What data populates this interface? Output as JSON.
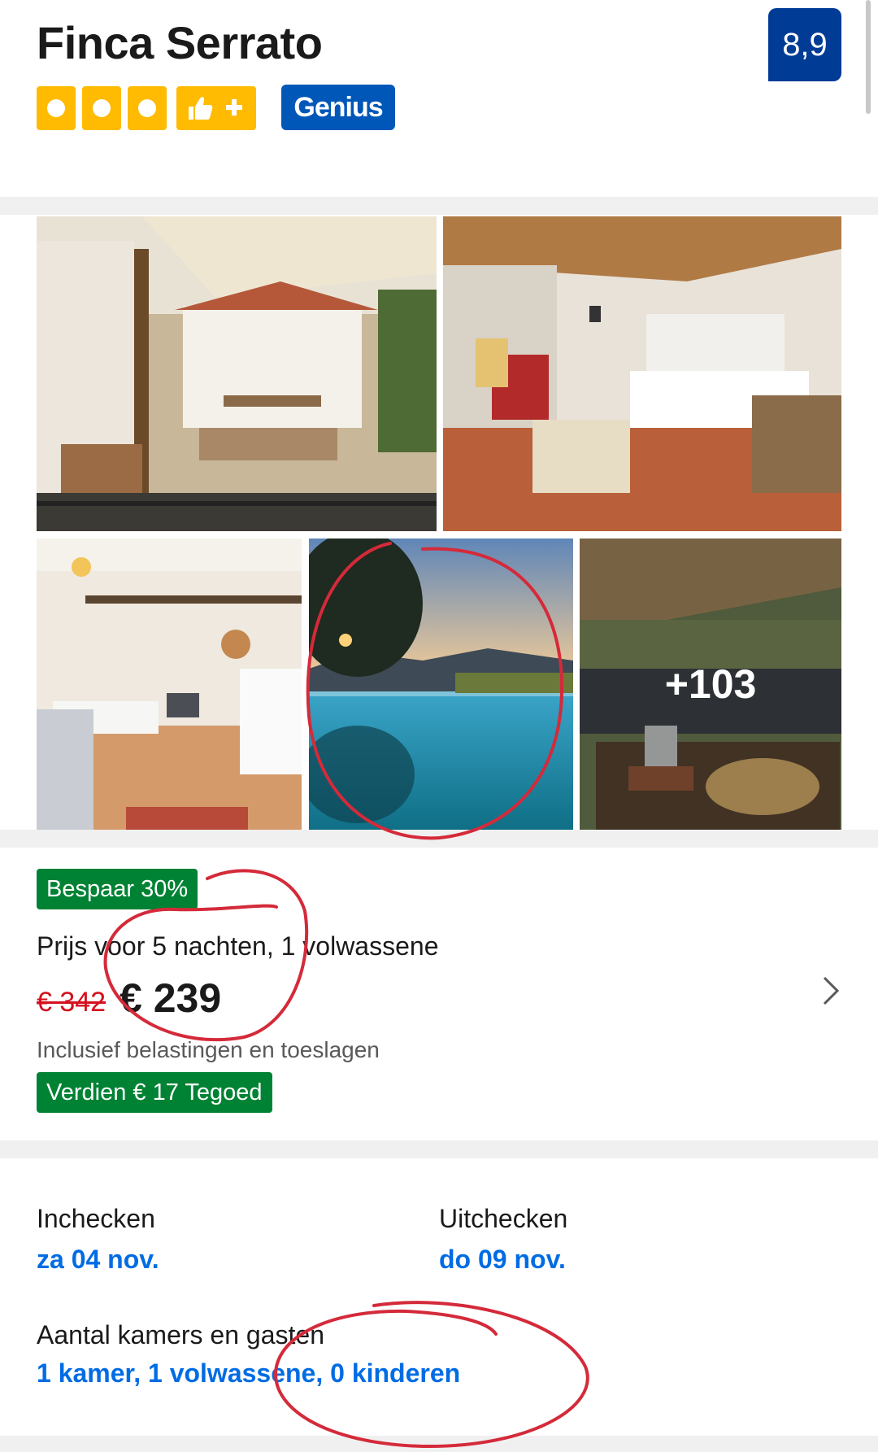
{
  "header": {
    "title": "Finca Serrato",
    "score": "8,9",
    "genius_label": "Genius"
  },
  "gallery": {
    "more_count": "+103"
  },
  "pricing": {
    "discount_badge": "Bespaar 30%",
    "price_description": "Prijs voor 5 nachten, 1 volwassene",
    "old_price": "€ 342",
    "new_price": "€ 239",
    "includes_note": "Inclusief belastingen en toeslagen",
    "credit_badge": "Verdien € 17 Tegoed"
  },
  "booking": {
    "checkin_label": "Inchecken",
    "checkin_value": "za 04 nov.",
    "checkout_label": "Uitchecken",
    "checkout_value": "do 09 nov.",
    "guests_label": "Aantal kamers en gasten",
    "guests_value": "1 kamer, 1 volwassene, 0 kinderen"
  },
  "colors": {
    "brand_blue": "#003b95",
    "link_blue": "#006ce4",
    "star_yellow": "#febb02",
    "green_badge": "#008234",
    "old_price_red": "#d4111e"
  }
}
